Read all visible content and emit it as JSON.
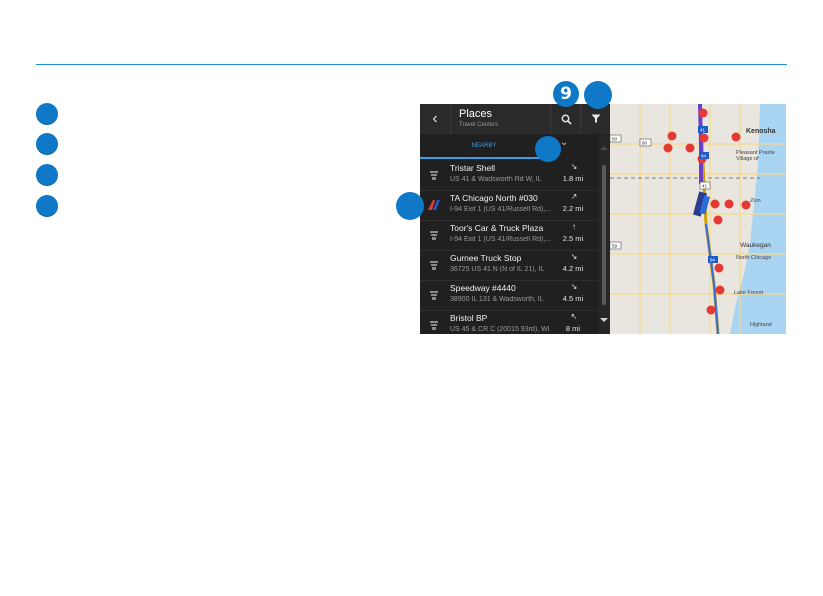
{
  "colors": {
    "callout": "#0f79c8",
    "rule": "#1e8fd6",
    "accent_tab": "#3f9de6",
    "poi_red": "#e53935"
  },
  "callouts": {
    "number_label": "9"
  },
  "places": {
    "title": "Places",
    "subtitle": "Travel Centers",
    "back_icon": "chevron-left-icon",
    "search_icon": "search-icon",
    "filter_icon": "filter-icon",
    "tab_nearby": "NEARBY",
    "items": [
      {
        "name": "Tristar Shell",
        "address": "US 41 & Wadsworth Rd W, IL",
        "dir": "↘",
        "dist": "1.8 mi",
        "icon": "fuel-pump-icon"
      },
      {
        "name": "TA Chicago North #030",
        "address": "I-94 Exit 1 (US 41/Russell Rd),...",
        "dir": "↗",
        "dist": "2.2 mi",
        "icon": "ta-logo-icon"
      },
      {
        "name": "Toor's Car & Truck Plaza",
        "address": "I-94 Exit 1 (US 41/Russell Rd),...",
        "dir": "↑",
        "dist": "2.5 mi",
        "icon": "fuel-pump-icon"
      },
      {
        "name": "Gurnee Truck Stop",
        "address": "36725 US 41 N (N of IL 21), IL",
        "dir": "↘",
        "dist": "4.2 mi",
        "icon": "fuel-pump-icon"
      },
      {
        "name": "Speedway #4440",
        "address": "38900 IL 131 & Wadsworth, IL",
        "dir": "↘",
        "dist": "4.5 mi",
        "icon": "fuel-pump-icon"
      },
      {
        "name": "Bristol BP",
        "address": "US 45 & CR C (20015 93rd), WI",
        "dir": "↖",
        "dist": "8 mi",
        "icon": "fuel-pump-icon"
      }
    ]
  },
  "map": {
    "labels": {
      "kenosha": "Kenosha",
      "pleasant_prairie": "Pleasant Prairie",
      "village_of": "Village of",
      "zion": "Zion",
      "waukegan": "Waukegan",
      "north_chicago": "North Chicago",
      "lake_forest": "Lake Forest",
      "highland": "Highland"
    },
    "shields": {
      "s50": "50",
      "s90": "90",
      "s41a": "41",
      "s94a": "94",
      "s41b": "41",
      "s59": "59",
      "s94b": "94"
    }
  }
}
